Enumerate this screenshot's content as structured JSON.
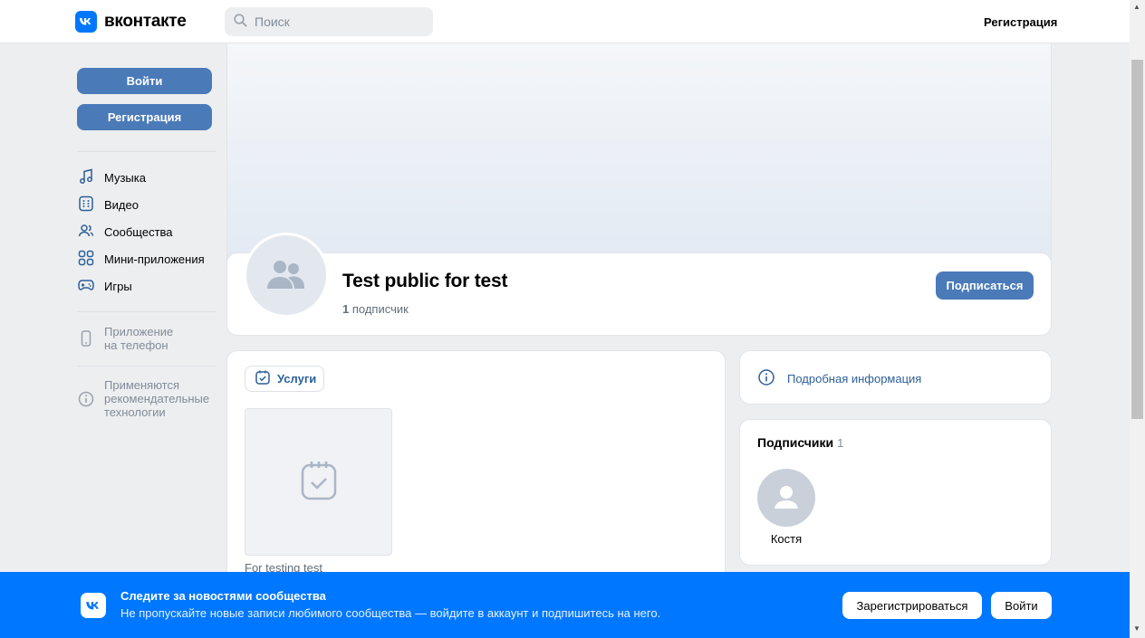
{
  "topbar": {
    "logo_text": "вконтакте",
    "search_placeholder": "Поиск",
    "register_label": "Регистрация"
  },
  "sidebar": {
    "login_label": "Войти",
    "register_label": "Регистрация",
    "items": [
      {
        "label": "Музыка",
        "icon": "music-icon"
      },
      {
        "label": "Видео",
        "icon": "video-icon"
      },
      {
        "label": "Сообщества",
        "icon": "communities-icon"
      },
      {
        "label": "Мини-приложения",
        "icon": "apps-icon"
      },
      {
        "label": "Игры",
        "icon": "games-icon"
      }
    ],
    "app_note": "Приложение на телефон",
    "app_note_line1": "Приложение",
    "app_note_line2": "на телефон",
    "rec_line1": "Применяются",
    "rec_line2": "рекомендательные",
    "rec_line3": "технологии"
  },
  "group": {
    "name": "Test public for test",
    "subscriber_count": "1",
    "subscriber_word": "подписчик",
    "subscribe_label": "Подписаться"
  },
  "services": {
    "tab_label": "Услуги",
    "item_caption": "For testing test"
  },
  "info": {
    "details_label": "Подробная информация"
  },
  "subscribers": {
    "title": "Подписчики",
    "count": "1",
    "members": [
      {
        "name": "Костя"
      }
    ]
  },
  "banner": {
    "title": "Следите за новостями сообщества",
    "text": "Не пропускайте новые записи любимого сообщества — войдите в аккаунт и подпишитесь на него.",
    "register_label": "Зарегистрироваться",
    "login_label": "Войти"
  },
  "colors": {
    "accent": "#0077ff",
    "button": "#4a7ab8",
    "link": "#2d5f99",
    "background": "#edeef0"
  }
}
